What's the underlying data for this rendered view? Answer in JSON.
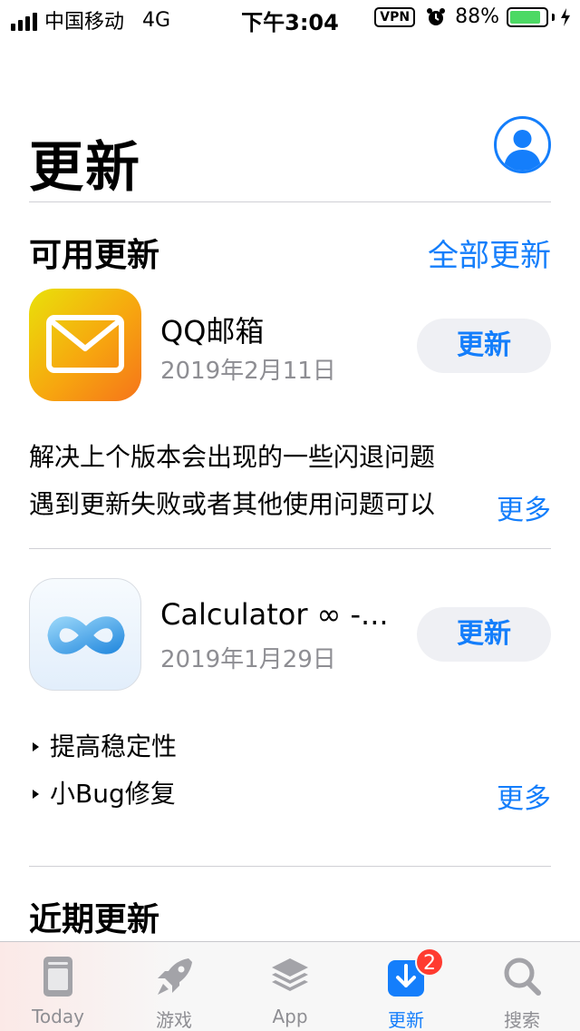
{
  "status_bar": {
    "carrier": "中国移动",
    "network": "4G",
    "time": "下午3:04",
    "vpn": "VPN",
    "battery_percent": "88%",
    "battery_level": 0.88,
    "battery_color": "#4cd964"
  },
  "header": {
    "title": "更新",
    "avatar_icon": "person-icon"
  },
  "available": {
    "title": "可用更新",
    "update_all_label": "全部更新",
    "apps": [
      {
        "name": "QQ邮箱",
        "date": "2019年2月11日",
        "button_label": "更新",
        "icon": "mail-envelope-icon",
        "notes": [
          "解决上个版本会出现的一些闪退问题",
          "遇到更新失败或者其他使用问题可以"
        ],
        "more_label": "更多"
      },
      {
        "name": "Calculator ∞ -...",
        "date": "2019年1月29日",
        "button_label": "更新",
        "icon": "infinity-icon",
        "notes": [
          "提高稳定性",
          "小Bug修复"
        ],
        "more_label": "更多"
      }
    ]
  },
  "recent": {
    "title": "近期更新"
  },
  "tab_bar": {
    "tabs": [
      {
        "label": "Today",
        "icon": "today-icon",
        "active": false
      },
      {
        "label": "游戏",
        "icon": "rocket-icon",
        "active": false
      },
      {
        "label": "App",
        "icon": "layers-icon",
        "active": false
      },
      {
        "label": "更新",
        "icon": "download-icon",
        "active": true,
        "badge": "2"
      },
      {
        "label": "搜索",
        "icon": "search-icon",
        "active": false
      }
    ]
  },
  "colors": {
    "accent": "#147efb",
    "badge": "#ff3b30",
    "secondary_text": "#8e8e93",
    "button_bg": "#eff0f4"
  }
}
